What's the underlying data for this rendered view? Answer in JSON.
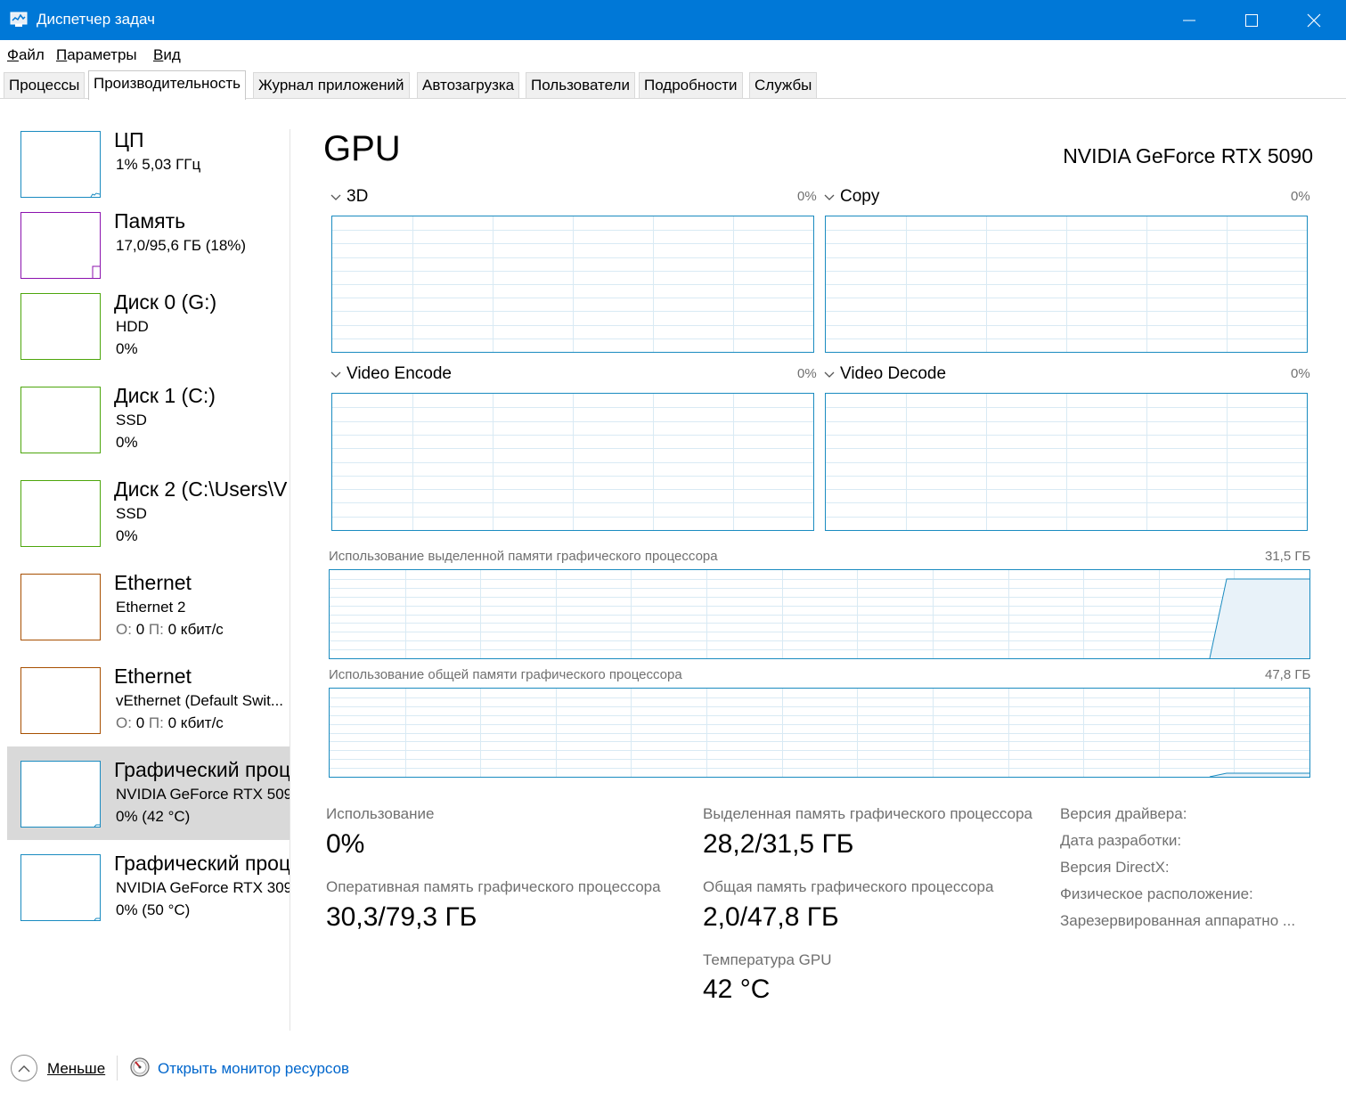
{
  "window": {
    "title": "Диспетчер задач"
  },
  "menu": {
    "file": {
      "hotkey": "Ф",
      "rest": "айл"
    },
    "options": {
      "hotkey": "П",
      "rest": "араметры"
    },
    "view": {
      "hotkey": "В",
      "rest": "ид"
    }
  },
  "tabs": [
    {
      "label": "Процессы"
    },
    {
      "label": "Производительность",
      "active": true
    },
    {
      "label": "Журнал приложений"
    },
    {
      "label": "Автозагрузка"
    },
    {
      "label": "Пользователи"
    },
    {
      "label": "Подробности"
    },
    {
      "label": "Службы"
    }
  ],
  "sidebar": {
    "items": [
      {
        "title": "ЦП",
        "line1": "1%  5,03 ГГц",
        "line2": "",
        "color": "#1a8bc0"
      },
      {
        "title": "Память",
        "line1": "17,0/95,6 ГБ (18%)",
        "line2": "",
        "color": "#8b12ae"
      },
      {
        "title": "Диск 0 (G:)",
        "line1": "HDD",
        "line2": "0%",
        "color": "#4da60c"
      },
      {
        "title": "Диск 1 (C:)",
        "line1": "SSD",
        "line2": "0%",
        "color": "#4da60c"
      },
      {
        "title": "Диск 2 (C:\\Users\\V",
        "line1": "SSD",
        "line2": "0%",
        "color": "#4da60c"
      },
      {
        "title": "Ethernet",
        "line1": "Ethernet 2",
        "line2_prefix_send": "О:",
        "line2_send": "0",
        "line2_prefix_recv": "П:",
        "line2_recv": "0 кбит/с",
        "color": "#a74f01"
      },
      {
        "title": "Ethernet",
        "line1": "vEthernet (Default Swit...",
        "line2_prefix_send": "О:",
        "line2_send": "0",
        "line2_prefix_recv": "П:",
        "line2_recv": "0 кбит/с",
        "color": "#a74f01"
      },
      {
        "title": "Графический проц",
        "line1": "NVIDIA GeForce RTX 509",
        "line2": "0% (42 °C)",
        "color": "#1a8bc0",
        "selected": true
      },
      {
        "title": "Графический проц",
        "line1": "NVIDIA GeForce RTX 309",
        "line2": "0% (50 °C)",
        "color": "#1a8bc0"
      }
    ]
  },
  "main": {
    "heading": "GPU",
    "model": "NVIDIA GeForce RTX 5090",
    "engines": [
      {
        "label": "3D",
        "percent": "0%"
      },
      {
        "label": "Copy",
        "percent": "0%"
      },
      {
        "label": "Video Encode",
        "percent": "0%"
      },
      {
        "label": "Video Decode",
        "percent": "0%"
      }
    ],
    "dedicated_graph": {
      "label": "Использование выделенной памяти графического процессора",
      "max": "31,5 ГБ"
    },
    "shared_graph": {
      "label": "Использование общей памяти графического процессора",
      "max": "47,8 ГБ"
    },
    "stats": {
      "usage_label": "Использование",
      "usage_value": "0%",
      "gpu_ram_label": "Оперативная память графического процессора",
      "gpu_ram_value": "30,3/79,3 ГБ",
      "dedicated_label": "Выделенная память графического процессора",
      "dedicated_value": "28,2/31,5 ГБ",
      "shared_label": "Общая память графического процессора",
      "shared_value": "2,0/47,8 ГБ",
      "temp_label": "Температура GPU",
      "temp_value": "42 °C"
    },
    "info": {
      "driver_version": "Версия драйвера:",
      "driver_date": "Дата разработки:",
      "directx": "Версия DirectX:",
      "physical_location": "Физическое расположение:",
      "reserved": "Зарезервированная аппаратно ..."
    }
  },
  "bottom": {
    "less": "Меньше",
    "monitor": "Открыть монитор ресурсов"
  },
  "colors": {
    "titlebar": "#0078d7",
    "graph_border": "#1a8bc0",
    "grid": "#d9eaf4",
    "link": "#0066cc"
  }
}
